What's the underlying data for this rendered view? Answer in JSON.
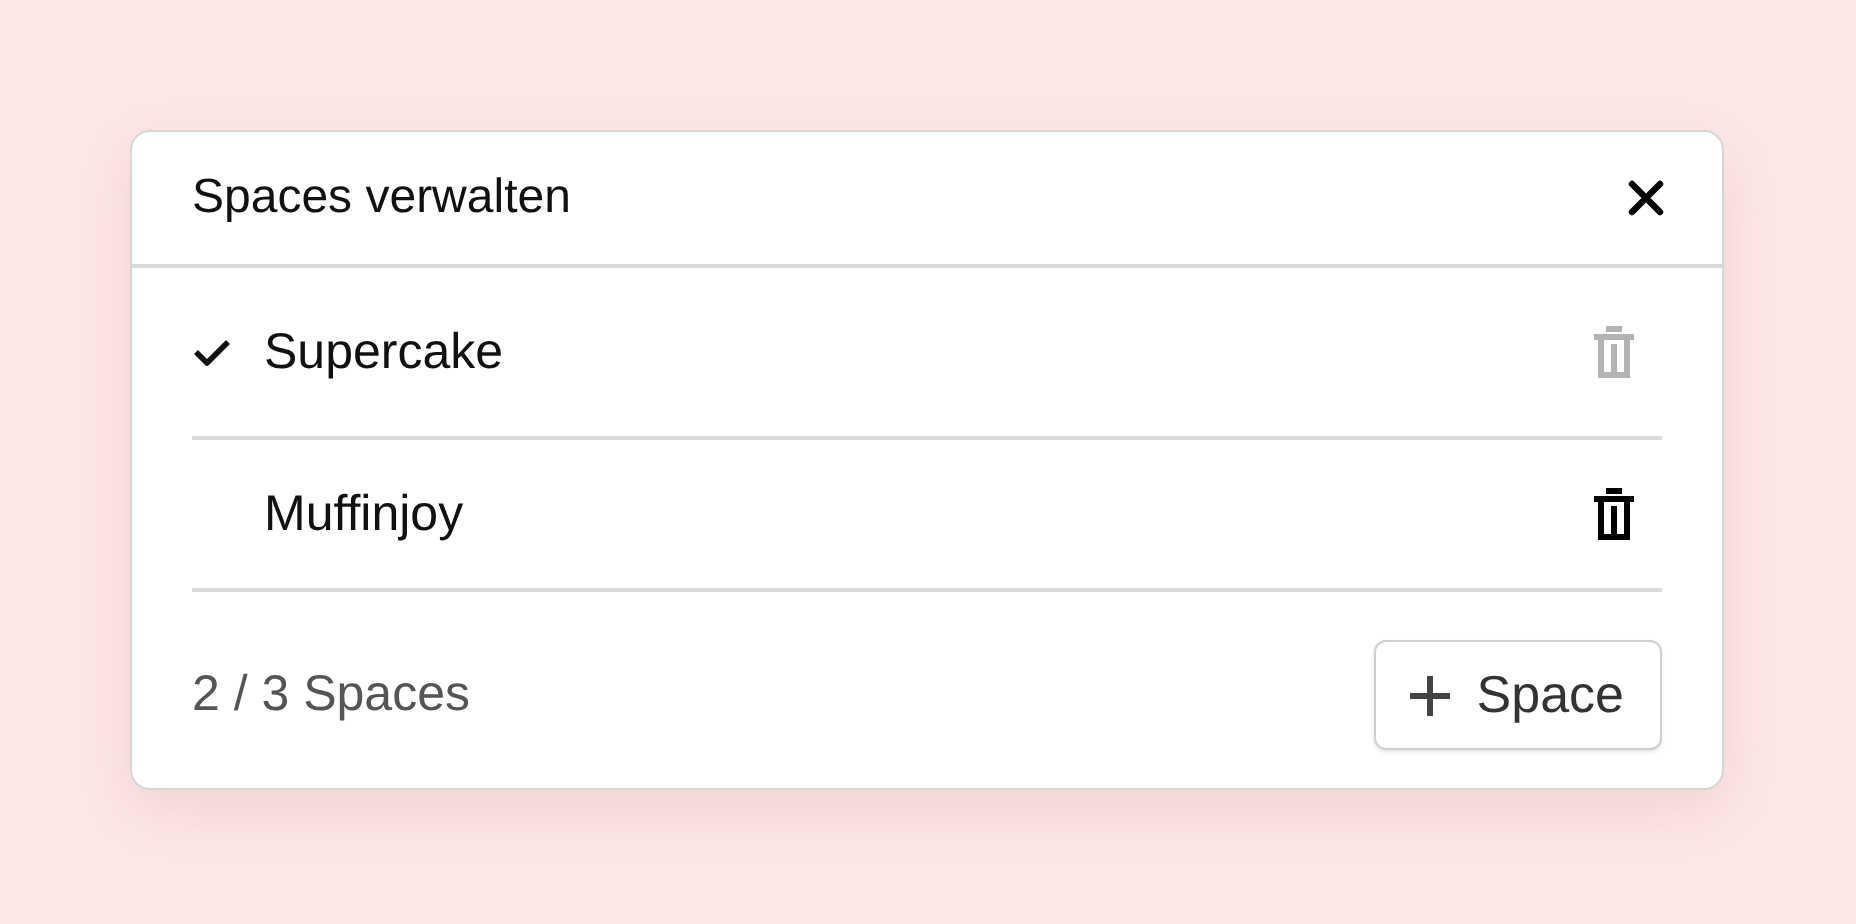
{
  "dialog": {
    "title": "Spaces verwalten"
  },
  "spaces": [
    {
      "name": "Supercake",
      "selected": true,
      "delete_disabled": true
    },
    {
      "name": "Muffinjoy",
      "selected": false,
      "delete_disabled": false
    }
  ],
  "footer": {
    "count": "2 / 3 Spaces",
    "add_button": "Space"
  }
}
